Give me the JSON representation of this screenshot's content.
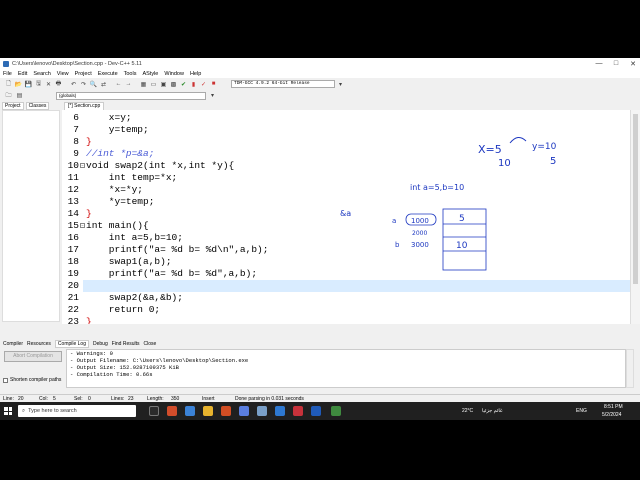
{
  "window": {
    "title": "C:\\Users\\lenovo\\Desktop\\Section.cpp - Dev-C++ 5.11",
    "minimize": "—",
    "maximize": "□",
    "close": "✕"
  },
  "menu": [
    "File",
    "Edit",
    "Search",
    "View",
    "Project",
    "Execute",
    "Tools",
    "AStyle",
    "Window",
    "Help"
  ],
  "toolbar": {
    "compiler": "TDM-GCC 4.9.2 64-bit Release",
    "scope": "(globals)"
  },
  "left_panel": {
    "tabs": [
      "Project",
      "Classes"
    ]
  },
  "editor": {
    "file_tab": "[*] Section.cpp",
    "lines": [
      {
        "n": "6",
        "text": "    x=y;",
        "style": "plain"
      },
      {
        "n": "7",
        "text": "    y=temp;",
        "style": "plain"
      },
      {
        "n": "8",
        "text": "}",
        "style": "red"
      },
      {
        "n": "9",
        "text": "//int *p=&a;",
        "style": "comment"
      },
      {
        "n": "10",
        "text": "void swap2(int *x,int *y){",
        "style": "plain"
      },
      {
        "n": "11",
        "text": "    int temp=*x;",
        "style": "plain"
      },
      {
        "n": "12",
        "text": "    *x=*y;",
        "style": "plain"
      },
      {
        "n": "13",
        "text": "    *y=temp;",
        "style": "plain"
      },
      {
        "n": "14",
        "text": "}",
        "style": "red"
      },
      {
        "n": "15",
        "text": "int main(){",
        "style": "plain"
      },
      {
        "n": "16",
        "text": "    int a=5,b=10;",
        "style": "plain"
      },
      {
        "n": "17",
        "text": "    printf(\"a= %d b= %d\\n\",a,b);",
        "style": "plain"
      },
      {
        "n": "18",
        "text": "    swap1(a,b);",
        "style": "plain"
      },
      {
        "n": "19",
        "text": "    printf(\"a= %d b= %d\",a,b);",
        "style": "plain"
      },
      {
        "n": "20",
        "text": "",
        "style": "plain"
      },
      {
        "n": "21",
        "text": "    swap2(&a,&b);",
        "style": "plain"
      },
      {
        "n": "22",
        "text": "    return 0;",
        "style": "plain"
      },
      {
        "n": "23",
        "text": "}",
        "style": "red"
      }
    ],
    "annotations": {
      "x_eq": "X=5",
      "y_eq": "y=10",
      "ten": "10",
      "five": "5",
      "decl": "int a=5,b=10",
      "amp_a": "&a",
      "label_a": "a",
      "label_b": "b",
      "addr_1000": "1000",
      "addr_2000": "2000",
      "addr_3000": "3000",
      "cell_5": "5",
      "cell_10": "10"
    }
  },
  "bottom_tabs": [
    "Compiler",
    "Resources",
    "Compile Log",
    "Debug",
    "Find Results",
    "Close"
  ],
  "bottom_panel": {
    "abort_label": "Abort Compilation",
    "shorten_label": "Shorten compiler paths",
    "log_lines": [
      "- Warnings: 0",
      "- Output Filename: C:\\Users\\lenovo\\Desktop\\Section.exe",
      "- Output Size: 152.9287109375 KiB",
      "- Compilation Time: 0.66s"
    ]
  },
  "status": {
    "line": "Line:",
    "line_val": "20",
    "col": "Col:",
    "col_val": "5",
    "sel": "Sel:",
    "sel_val": "0",
    "lines": "Lines:",
    "lines_val": "23",
    "length": "Length:",
    "length_val": "350",
    "mode": "Insert",
    "message": "Done parsing in 0.031 seconds"
  },
  "taskbar": {
    "search_placeholder": "Type here to search",
    "weather": "22°C",
    "weather_desc": "غائم جزئيا",
    "lang": "ENG",
    "time": "8:51 PM",
    "date": "5/2/2024"
  }
}
